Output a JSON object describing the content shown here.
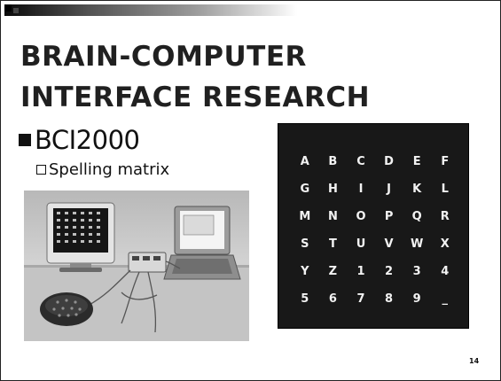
{
  "slide": {
    "title_line1": "BRAIN-COMPUTER",
    "title_line2": "INTERFACE RESEARCH",
    "bullet": "BCI2000",
    "sub_bullet": "Spelling matrix",
    "page_number": "14"
  },
  "matrix": {
    "cells": [
      "A",
      "B",
      "C",
      "D",
      "E",
      "F",
      "G",
      "H",
      "I",
      "J",
      "K",
      "L",
      "M",
      "N",
      "O",
      "P",
      "Q",
      "R",
      "S",
      "T",
      "U",
      "V",
      "W",
      "X",
      "Y",
      "Z",
      "1",
      "2",
      "3",
      "4",
      "5",
      "6",
      "7",
      "8",
      "9",
      "_"
    ]
  },
  "colors": {
    "matrix_background": "#181818",
    "matrix_text": "#f2f2f2",
    "title_text": "#202020"
  }
}
